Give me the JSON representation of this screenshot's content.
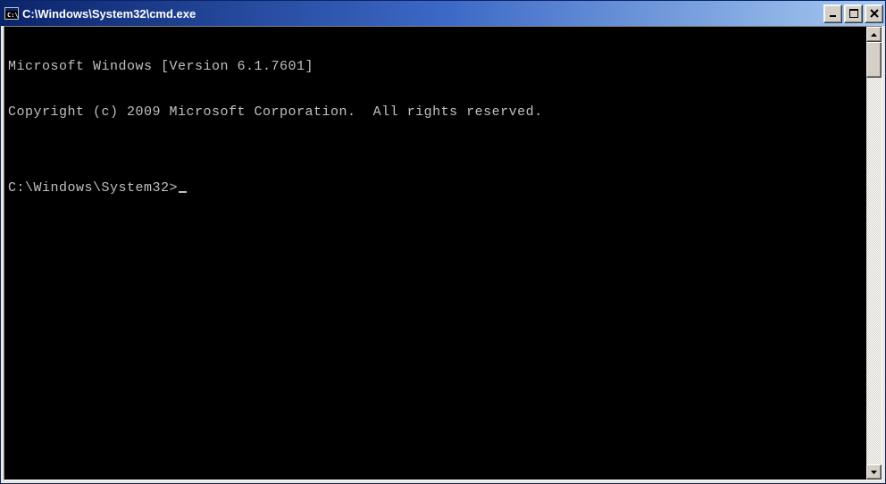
{
  "window": {
    "title": "C:\\Windows\\System32\\cmd.exe"
  },
  "console": {
    "lines": [
      "Microsoft Windows [Version 6.1.7601]",
      "Copyright (c) 2009 Microsoft Corporation.  All rights reserved.",
      "",
      "C:\\Windows\\System32>"
    ]
  }
}
